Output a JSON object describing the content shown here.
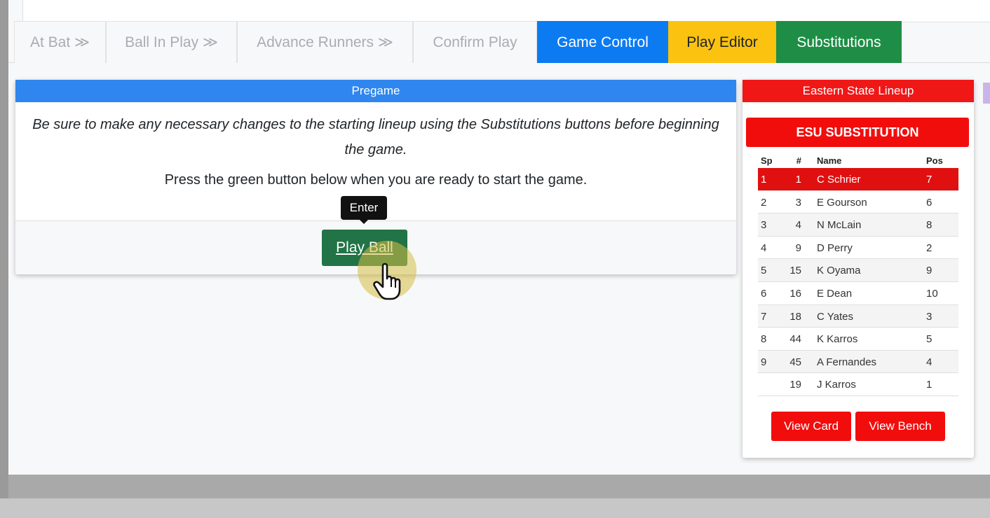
{
  "tabs": [
    {
      "label": "At Bat ≫",
      "state": "disabled"
    },
    {
      "label": "Ball In Play ≫",
      "state": "disabled"
    },
    {
      "label": "Advance Runners ≫",
      "state": "disabled"
    },
    {
      "label": "Confirm Play",
      "state": "disabled"
    },
    {
      "label": "Game Control",
      "state": "blue"
    },
    {
      "label": "Play Editor",
      "state": "yellow"
    },
    {
      "label": "Substitutions",
      "state": "green"
    }
  ],
  "pregame": {
    "title": "Pregame",
    "message_italic": "Be sure to make any necessary changes to the starting lineup using the Substitutions buttons before beginning the game.",
    "message_plain": "Press the green button below when you are ready to start the game.",
    "tooltip": "Enter",
    "play_button": "Play Ball"
  },
  "lineup": {
    "title": "Eastern State Lineup",
    "substitution_button": "ESU SUBSTITUTION",
    "headers": {
      "sp": "Sp",
      "num": "#",
      "name": "Name",
      "pos": "Pos"
    },
    "rows": [
      {
        "sp": "1",
        "num": "1",
        "name": "C Schrier",
        "pos": "7",
        "active": true
      },
      {
        "sp": "2",
        "num": "3",
        "name": "E Gourson",
        "pos": "6"
      },
      {
        "sp": "3",
        "num": "4",
        "name": "N McLain",
        "pos": "8"
      },
      {
        "sp": "4",
        "num": "9",
        "name": "D Perry",
        "pos": "2"
      },
      {
        "sp": "5",
        "num": "15",
        "name": "K Oyama",
        "pos": "9"
      },
      {
        "sp": "6",
        "num": "16",
        "name": "E Dean",
        "pos": "10"
      },
      {
        "sp": "7",
        "num": "18",
        "name": "C Yates",
        "pos": "3"
      },
      {
        "sp": "8",
        "num": "44",
        "name": "K Karros",
        "pos": "5"
      },
      {
        "sp": "9",
        "num": "45",
        "name": "A Fernandes",
        "pos": "4"
      },
      {
        "sp": "",
        "num": "19",
        "name": "J Karros",
        "pos": "1"
      }
    ],
    "view_card_button": "View Card",
    "view_bench_button": "View Bench"
  },
  "colors": {
    "game_control": "#0c7bf2",
    "play_editor": "#fbc210",
    "substitutions": "#1e8e46",
    "pregame_header": "#2f86ee",
    "lineup_red": "#f01717",
    "play_ball_green": "#227345"
  },
  "icons": {
    "cursor": "pointer-hand-icon"
  }
}
